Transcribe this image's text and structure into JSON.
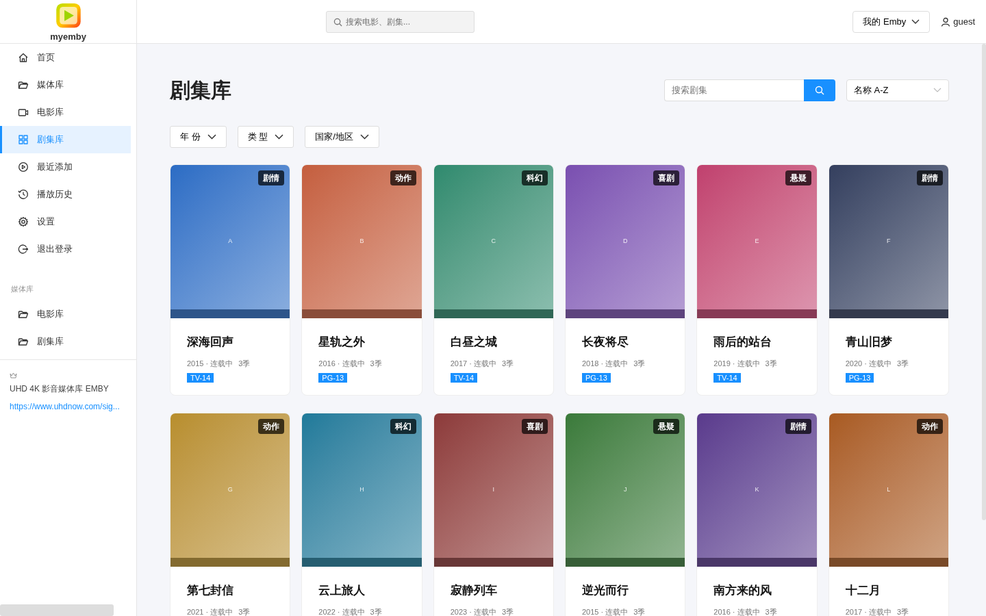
{
  "app": {
    "name": "myemby"
  },
  "sidebar": {
    "items": [
      {
        "label": "首页",
        "kind": "home",
        "selected": false
      },
      {
        "label": "媒体库",
        "kind": "folder",
        "selected": false
      },
      {
        "label": "电影库",
        "kind": "video",
        "selected": false
      },
      {
        "label": "剧集库",
        "kind": "grid",
        "selected": true
      },
      {
        "label": "最近添加",
        "kind": "play",
        "selected": false
      },
      {
        "label": "播放历史",
        "kind": "clock",
        "selected": false
      },
      {
        "label": "设置",
        "kind": "gear",
        "selected": false
      },
      {
        "label": "退出登录",
        "kind": "logout",
        "selected": false
      }
    ],
    "section_title": "媒体库",
    "section_items": [
      {
        "label": "电影库",
        "kind": "folder",
        "selected": false
      },
      {
        "label": "剧集库",
        "kind": "folder",
        "selected": false
      }
    ],
    "footer": {
      "title": "UHD 4K 影音媒体库 EMBY",
      "link": "https://www.uhdnow.com/sig..."
    }
  },
  "header": {
    "search": {
      "placeholder": "搜索电影、剧集..."
    },
    "menu": "我的 Emby",
    "user": "guest"
  },
  "page": {
    "title": "剧集库",
    "search": {
      "placeholder": "搜索剧集"
    },
    "sort": "名称 A-Z",
    "filters": [
      "年 份",
      "类 型",
      "国家/地区"
    ]
  },
  "shows": [
    {
      "title": "深海回声",
      "letter": "A",
      "genre": "剧情",
      "meta": "2015 · 连载中",
      "seasons": "3季",
      "rating": "TV-14",
      "color": "#2b6cc4"
    },
    {
      "title": "星轨之外",
      "letter": "B",
      "genre": "动作",
      "meta": "2016 · 连载中",
      "seasons": "3季",
      "rating": "PG-13",
      "color": "#c45e3e"
    },
    {
      "title": "白昼之城",
      "letter": "C",
      "genre": "科幻",
      "meta": "2017 · 连载中",
      "seasons": "3季",
      "rating": "TV-14",
      "color": "#2e8a6e"
    },
    {
      "title": "长夜将尽",
      "letter": "D",
      "genre": "喜剧",
      "meta": "2018 · 连载中",
      "seasons": "3季",
      "rating": "PG-13",
      "color": "#7a4fb0"
    },
    {
      "title": "雨后的站台",
      "letter": "E",
      "genre": "悬疑",
      "meta": "2019 · 连载中",
      "seasons": "3季",
      "rating": "TV-14",
      "color": "#c0406e"
    },
    {
      "title": "青山旧梦",
      "letter": "F",
      "genre": "剧情",
      "meta": "2020 · 连载中",
      "seasons": "3季",
      "rating": "PG-13",
      "color": "#343f5e"
    },
    {
      "title": "第七封信",
      "letter": "G",
      "genre": "动作",
      "meta": "2021 · 连载中",
      "seasons": "3季",
      "color": "#b88e2c"
    },
    {
      "title": "云上旅人",
      "letter": "H",
      "genre": "科幻",
      "meta": "2022 · 连载中",
      "seasons": "3季",
      "color": "#1e7a9a"
    },
    {
      "title": "寂静列车",
      "letter": "I",
      "genre": "喜剧",
      "meta": "2023 · 连载中",
      "seasons": "3季",
      "color": "#8c3a3a"
    },
    {
      "title": "逆光而行",
      "letter": "J",
      "genre": "悬疑",
      "meta": "2015 · 连载中",
      "seasons": "3季",
      "color": "#3a7a3a"
    },
    {
      "title": "南方来的风",
      "letter": "K",
      "genre": "剧情",
      "meta": "2016 · 连载中",
      "seasons": "3季",
      "color": "#5a3a8c"
    },
    {
      "title": "十二月",
      "letter": "L",
      "genre": "动作",
      "meta": "2017 · 连载中",
      "seasons": "3季",
      "color": "#a85a20"
    }
  ]
}
